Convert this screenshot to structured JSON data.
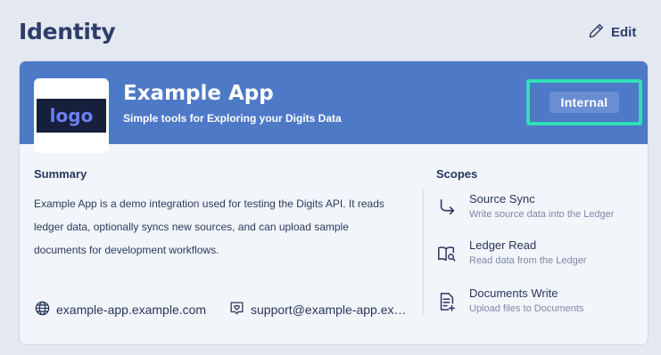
{
  "page": {
    "title": "Identity",
    "edit_label": "Edit"
  },
  "app": {
    "logo_text": "logo",
    "name": "Example App",
    "tagline": "Simple tools for Exploring your Digits Data",
    "badge": "Internal"
  },
  "summary": {
    "title": "Summary",
    "text": "Example App is a demo integration used for testing the Digits API. It reads ledger data, optionally syncs new sources, and can upload sample documents for development workflows.",
    "website": "example-app.example.com",
    "support_email": "support@example-app.ex…"
  },
  "scopes": {
    "title": "Scopes",
    "items": [
      {
        "name": "Source Sync",
        "description": "Write source data into the Ledger",
        "icon": "arrow-turn-icon"
      },
      {
        "name": "Ledger Read",
        "description": "Read data from the Ledger",
        "icon": "book-search-icon"
      },
      {
        "name": "Documents Write",
        "description": "Upload files to Documents",
        "icon": "document-plus-icon"
      }
    ]
  },
  "colors": {
    "banner": "#4d79c7",
    "highlight": "#2fe0b7",
    "background": "#e4e9f1"
  }
}
